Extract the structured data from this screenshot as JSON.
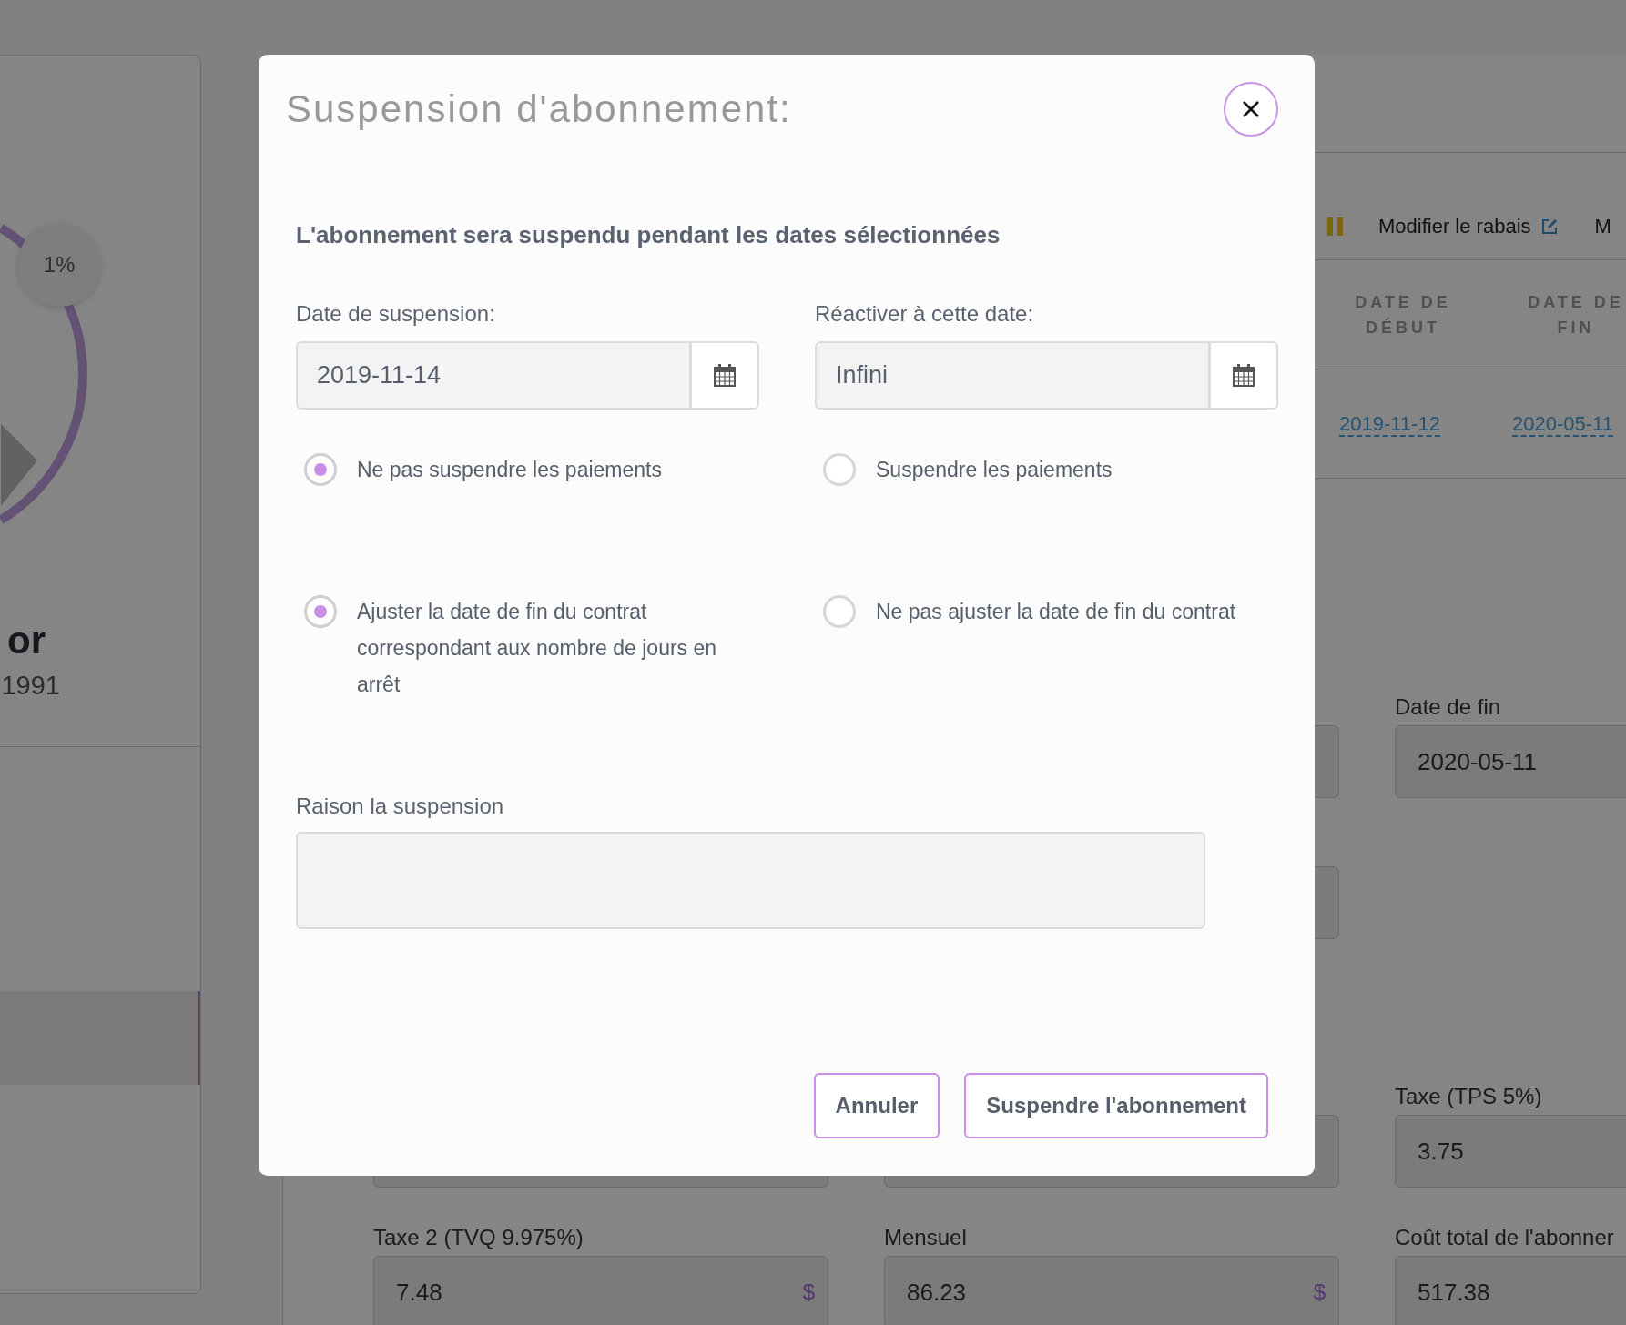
{
  "background": {
    "profile_card": {
      "badge": "1%",
      "name": "or",
      "year": "1991"
    },
    "toolbar": {
      "actions": [
        {
          "kind": "edit",
          "label": "Modifier le rabais"
        },
        {
          "kind": "text",
          "label": "M"
        }
      ]
    },
    "table": {
      "columns": [
        "DATE DE DÉBUT",
        "DATE DE FIN"
      ],
      "rows": [
        [
          "2019-11-12",
          "2020-05-11"
        ]
      ]
    },
    "form": {
      "rows": [
        [
          null,
          null,
          {
            "label": "Date de fin",
            "value": "2020-05-11"
          }
        ],
        [
          null,
          null
        ],
        [
          null,
          null,
          {
            "label": "Taxe (TPS 5%)",
            "value": "3.75"
          }
        ],
        [
          {
            "label": "Taxe 2 (TVQ 9.975%)",
            "value": "7.48",
            "unit": "$"
          },
          {
            "label": "Mensuel",
            "value": "86.23",
            "unit": "$"
          },
          {
            "label": "Coût total de l'abonner",
            "value": "517.38"
          }
        ]
      ]
    }
  },
  "modal": {
    "title": "Suspension d'abonnement:",
    "subtitle": "L'abonnement sera suspendu pendant les dates sélectionnées",
    "date_fields": [
      {
        "label": "Date de suspension:",
        "value": "2019-11-14"
      },
      {
        "label": "Réactiver à cette date:",
        "value": "Infini"
      }
    ],
    "radio_groups": [
      {
        "options": [
          {
            "label": "Ne pas suspendre les paiements",
            "selected": true
          },
          {
            "label": "Suspendre les paiements",
            "selected": false
          }
        ]
      },
      {
        "options": [
          {
            "label": "Ajuster la date de fin du contrat correspondant aux nombre de jours en arrêt",
            "selected": true
          },
          {
            "label": "Ne pas ajuster la date de fin du contrat",
            "selected": false
          }
        ]
      }
    ],
    "reason": {
      "label": "Raison la suspension"
    },
    "buttons": [
      "Annuler",
      "Suspendre l'abonnement"
    ]
  }
}
